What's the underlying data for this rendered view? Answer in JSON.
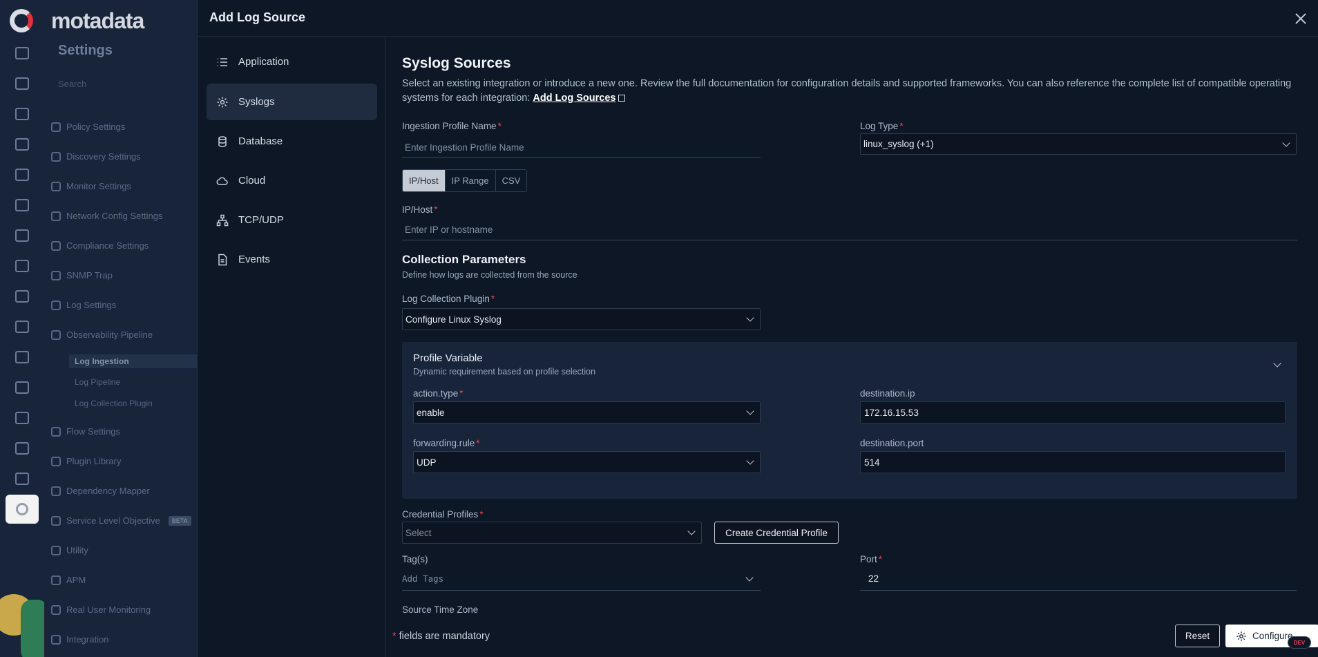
{
  "background": {
    "brand": "motadata",
    "section_title": "Settings",
    "search_placeholder": "Search",
    "menu": [
      {
        "label": "Policy Settings"
      },
      {
        "label": "Discovery Settings"
      },
      {
        "label": "Monitor Settings"
      },
      {
        "label": "Network Config Settings"
      },
      {
        "label": "Compliance Settings"
      },
      {
        "label": "SNMP Trap"
      },
      {
        "label": "Log Settings"
      },
      {
        "label": "Observability Pipeline"
      },
      {
        "label": "Log Ingestion"
      },
      {
        "label": "Log Pipeline"
      },
      {
        "label": "Log Collection Plugin"
      },
      {
        "label": "Flow Settings"
      },
      {
        "label": "Plugin Library"
      },
      {
        "label": "Dependency Mapper"
      },
      {
        "label": "Service Level Objective",
        "badge": "BETA"
      },
      {
        "label": "Utility"
      },
      {
        "label": "APM"
      },
      {
        "label": "Real User Monitoring"
      },
      {
        "label": "Integration"
      }
    ]
  },
  "modal": {
    "title": "Add Log Source",
    "nav": [
      {
        "label": "Application",
        "icon": "list-icon"
      },
      {
        "label": "Syslogs",
        "icon": "gear-icon"
      },
      {
        "label": "Database",
        "icon": "database-icon"
      },
      {
        "label": "Cloud",
        "icon": "cloud-icon"
      },
      {
        "label": "TCP/UDP",
        "icon": "network-icon"
      },
      {
        "label": "Events",
        "icon": "document-icon"
      }
    ],
    "active_nav": "Syslogs"
  },
  "form": {
    "heading": "Syslog Sources",
    "description": "Select an existing integration or introduce a new one. Review the full documentation for configuration details and supported frameworks. You can also reference the complete list of compatible operating systems for each integration:",
    "description_link": "Add Log Sources",
    "ingestion_profile_label": "Ingestion Profile Name",
    "ingestion_profile_placeholder": "Enter Ingestion Profile Name",
    "log_type_label": "Log Type",
    "log_type_value": "linux_syslog (+1)",
    "target_tabs": [
      "IP/Host",
      "IP Range",
      "CSV"
    ],
    "target_tab_selected": "IP/Host",
    "ip_host_label": "IP/Host",
    "ip_host_placeholder": "Enter IP or hostname",
    "collection_heading": "Collection Parameters",
    "collection_sub": "Define how logs are collected from the source",
    "plugin_label": "Log Collection Plugin",
    "plugin_value": "Configure Linux Syslog",
    "profile_variable": {
      "title": "Profile Variable",
      "subtitle": "Dynamic requirement based on profile selection",
      "action_type_label": "action.type",
      "action_type_value": "enable",
      "destination_ip_label": "destination.ip",
      "destination_ip_value": "172.16.15.53",
      "forwarding_rule_label": "forwarding.rule",
      "forwarding_rule_value": "UDP",
      "destination_port_label": "destination.port",
      "destination_port_value": "514"
    },
    "credential_label": "Credential Profiles",
    "credential_placeholder": "Select",
    "create_credential_button": "Create Credential Profile",
    "tags_label": "Tag(s)",
    "tags_placeholder": "Add Tags",
    "port_label": "Port",
    "port_value": "22",
    "time_zone_label": "Source Time Zone"
  },
  "footer": {
    "mandatory_note": "fields are mandatory",
    "reset_button": "Reset",
    "configure_button": "Configure",
    "env_badge": "DEV"
  }
}
